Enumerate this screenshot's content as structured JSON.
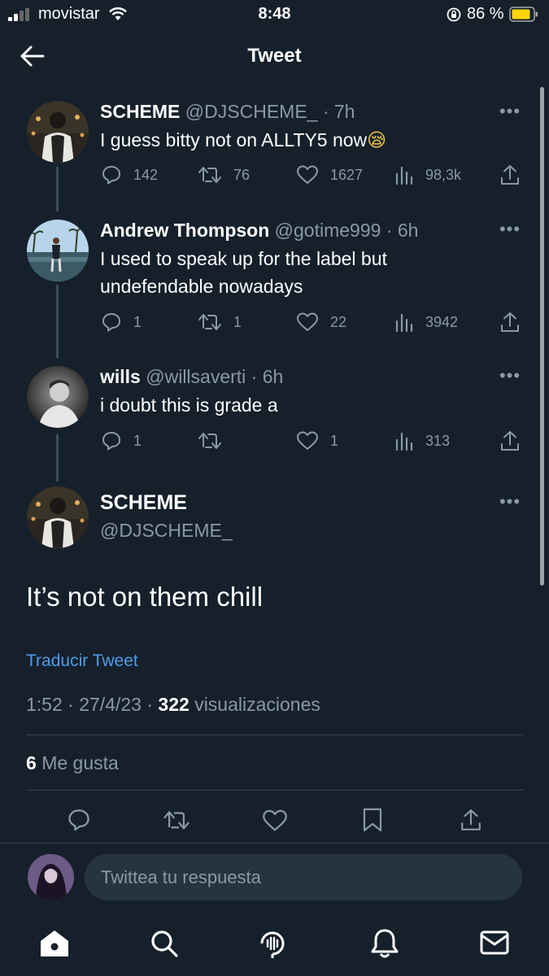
{
  "status_bar": {
    "carrier": "movistar",
    "time": "8:48",
    "battery": "86 %"
  },
  "header": {
    "title": "Tweet"
  },
  "thread": [
    {
      "name": "SCHEME",
      "handle": "@DJSCHEME_ · 7h",
      "text": "I guess bitty not on ALLTY5 now",
      "emoji": "😪",
      "replies": "142",
      "retweets": "76",
      "likes": "1627",
      "views": "98,3k"
    },
    {
      "name": "Andrew Thompson",
      "handle": "@gotime999 · 6h",
      "text_line1": "I used to speak up for the label but",
      "text_line2": "undefendable nowadays",
      "replies": "1",
      "retweets": "1",
      "likes": "22",
      "views": "3942"
    },
    {
      "name": "wills",
      "handle": "@willsaverti · 6h",
      "text": "i doubt this is grade a",
      "replies": "1",
      "retweets": "",
      "likes": "1",
      "views": "313"
    }
  ],
  "main_tweet": {
    "name": "SCHEME",
    "handle": "@DJSCHEME_",
    "text": "It’s not on them chill",
    "translate": "Traducir Tweet",
    "time": "1:52",
    "date": "27/4/23",
    "views_count": "322",
    "views_label": "visualizaciones",
    "likes_count": "6",
    "likes_label": "Me gusta"
  },
  "reply": {
    "placeholder": "Twittea tu respuesta"
  },
  "icons": {
    "action": [
      "reply-icon",
      "retweet-icon",
      "like-icon",
      "views-icon",
      "share-icon"
    ],
    "main_actions": [
      "reply-icon",
      "retweet-icon",
      "like-icon",
      "bookmark-icon",
      "share-icon"
    ],
    "nav": [
      "home-icon",
      "search-icon",
      "spaces-icon",
      "notifications-icon",
      "messages-icon"
    ]
  },
  "colors": {
    "background": "#15202b",
    "text": "#ffffff",
    "muted": "#8b98a5",
    "link": "#4f9be8",
    "battery": "#ffd60a",
    "input": "#273340"
  }
}
